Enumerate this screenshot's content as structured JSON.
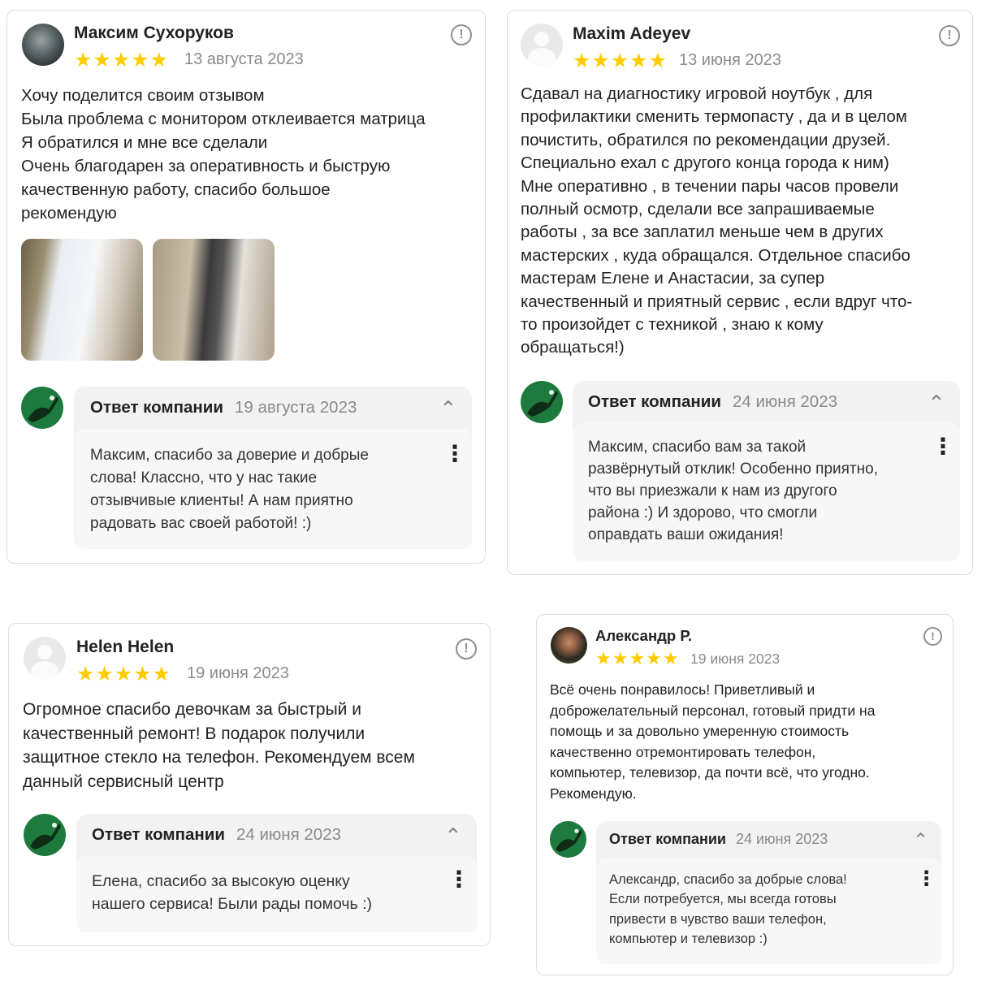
{
  "reviews": [
    {
      "author": "Максим Сухоруков",
      "stars": "★★★★★",
      "date": "13 августа 2023",
      "text": [
        "Хочу поделится своим отзывом",
        "Была проблема с монитором отклеивается матрица",
        "Я обратился и мне все сделали",
        "Очень благодарен за оперативность и быструю",
        "качественную работу, спасибо большое",
        "рекомендую"
      ],
      "reply": {
        "title": "Ответ компании",
        "date": "19 августа 2023",
        "text": [
          "Максим, спасибо за доверие и добрые",
          "слова! Классно, что у нас такие",
          "отзывчивые клиенты! А нам приятно",
          "радовать вас своей работой! :)"
        ]
      }
    },
    {
      "author": "Maxim Adeyev",
      "stars": "★★★★★",
      "date": "13 июня 2023",
      "text": [
        "Сдавал на диагностику игровой ноутбук , для",
        "профилактики сменить термопасту , да и в целом",
        "почистить, обратился по рекомендации друзей.",
        "Специально ехал с другого конца города к ним)",
        "Мне оперативно , в течении пары часов провели",
        "полный осмотр, сделали все запрашиваемые",
        "работы , за все заплатил меньше чем в других",
        "мастерских , куда обращался. Отдельное спасибо",
        "мастерам Елене и Анастасии, за супер",
        "качественный и приятный сервис , если вдруг что-",
        "то произойдет с техникой , знаю к кому",
        "обращаться!)"
      ],
      "reply": {
        "title": "Ответ компании",
        "date": "24 июня 2023",
        "text": [
          "Максим, спасибо вам за такой",
          "развёрнутый отклик! Особенно приятно,",
          "что вы приезжали к нам из другого",
          "района :) И здорово, что смогли",
          "оправдать ваши ожидания!"
        ]
      }
    },
    {
      "author": "Helen Helen",
      "stars": "★★★★★",
      "date": "19 июня 2023",
      "text": [
        "Огромное спасибо девочкам за быстрый и",
        "качественный ремонт! В подарок получили",
        "защитное стекло на телефон. Рекомендуем всем",
        "данный сервисный центр"
      ],
      "reply": {
        "title": "Ответ компании",
        "date": "24 июня 2023",
        "text": [
          "Елена, спасибо за высокую оценку",
          "нашего сервиса! Были рады помочь :)"
        ]
      }
    },
    {
      "author": "Александр Р.",
      "stars": "★★★★★",
      "date": "19 июня 2023",
      "text": [
        "Всё очень понравилось! Приветливый и",
        "доброжелательный персонал, готовый придти на",
        "помощь и за довольно умеренную стоимость",
        "качественно отремонтировать телефон,",
        "компьютер, телевизор, да почти всё, что угодно.",
        "Рекомендую."
      ],
      "reply": {
        "title": "Ответ компании",
        "date": "24 июня 2023",
        "text": [
          "Александр, спасибо за добрые слова!",
          "Если потребуется, мы всегда готовы",
          "привести в чувство ваши телефон,",
          "компьютер и телевизор :)"
        ]
      }
    }
  ],
  "icons": {
    "report": "!",
    "chevron": "⌃",
    "kebab": "⋮"
  },
  "colors": {
    "star": "#ffcc00",
    "company_avatar": "#1d7a3e",
    "reply_bg": "#f2f2f2"
  }
}
